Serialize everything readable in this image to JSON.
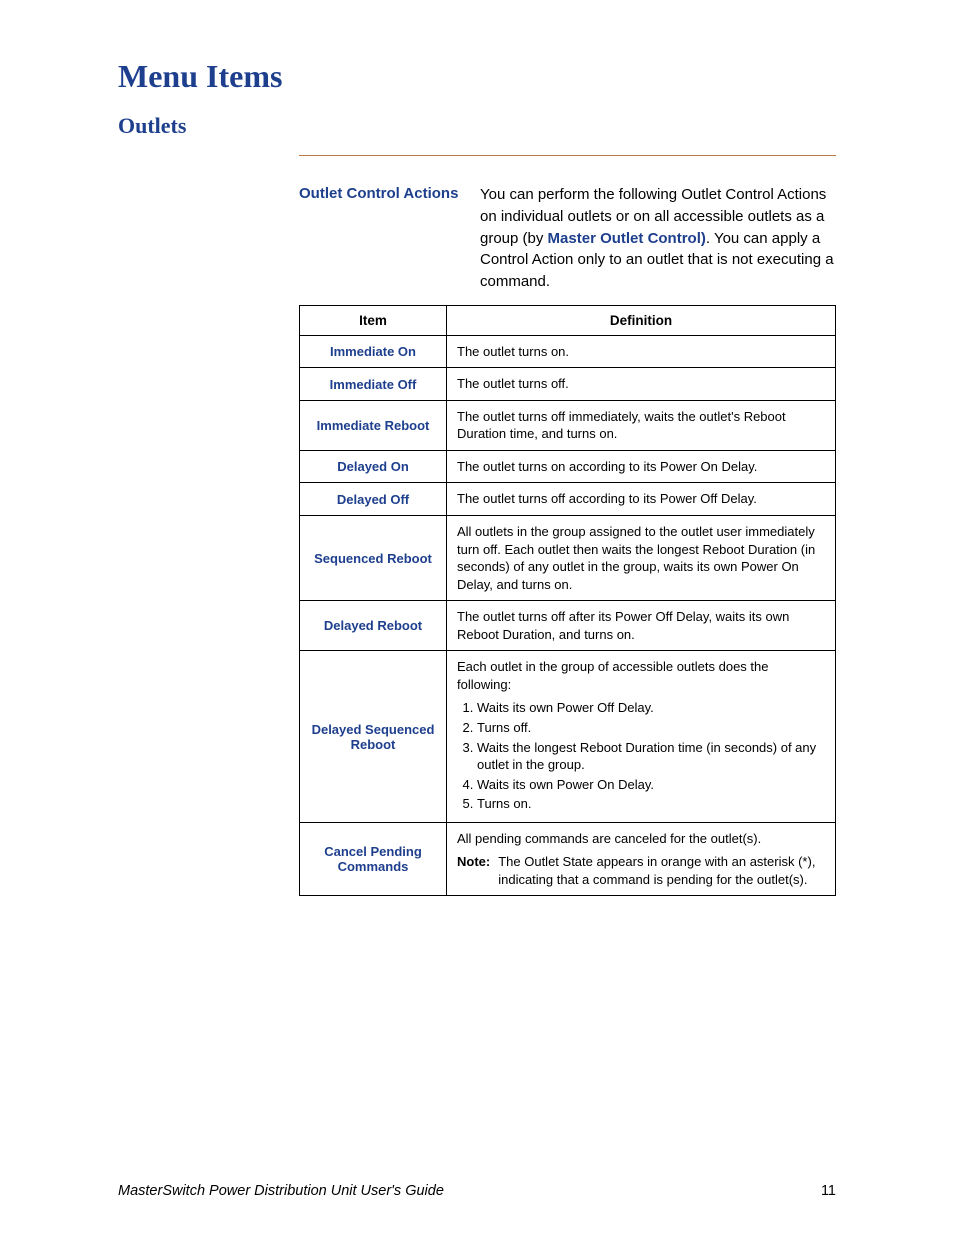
{
  "heading": "Menu Items",
  "subheading": "Outlets",
  "sidehead": "Outlet Control Actions",
  "intro_pre": "You can perform the following Outlet Control Actions on individual outlets or on all accessible outlets as a group (by ",
  "intro_link": "Master Outlet Control)",
  "intro_post": ". You can apply a Control Action only to an outlet that is not executing a command.",
  "table": {
    "head_item": "Item",
    "head_def": "Definition",
    "rows": [
      {
        "item": "Immediate On",
        "def_paras": [
          "The outlet turns on."
        ]
      },
      {
        "item": "Immediate Off",
        "def_paras": [
          "The outlet turns off."
        ]
      },
      {
        "item": "Immediate Reboot",
        "def_paras": [
          "The outlet turns off immediately, waits the outlet's Reboot Duration time, and turns on."
        ]
      },
      {
        "item": "Delayed On",
        "def_paras": [
          "The outlet turns on according to its Power On Delay."
        ]
      },
      {
        "item": "Delayed Off",
        "def_paras": [
          "The outlet turns off according to its Power Off Delay."
        ]
      },
      {
        "item": "Sequenced Reboot",
        "def_paras": [
          "All outlets in the group assigned to the outlet user immediately turn off. Each outlet then waits the longest Reboot Duration (in seconds) of any outlet in the group, waits its own Power On Delay, and turns on."
        ]
      },
      {
        "item": "Delayed Reboot",
        "def_paras": [
          "The outlet turns off after its Power Off Delay, waits its own Reboot Duration, and turns on."
        ]
      },
      {
        "item": "Delayed Sequenced Reboot",
        "def_paras": [
          "Each outlet in the group of accessible outlets does the following:"
        ],
        "list": [
          "Waits its own Power Off Delay.",
          "Turns off.",
          "Waits the longest Reboot Duration time (in seconds) of any outlet in the group.",
          "Waits its own Power On Delay.",
          "Turns on."
        ]
      },
      {
        "item": "Cancel Pending Commands",
        "def_paras": [
          "All pending commands are canceled for the outlet(s)."
        ],
        "note_label": "Note:",
        "note_body": "The Outlet State appears in orange with an asterisk (*), indicating that a command is pending for the outlet(s)."
      }
    ]
  },
  "footer_left": "MasterSwitch Power Distribution Unit User's Guide",
  "footer_right": "11"
}
